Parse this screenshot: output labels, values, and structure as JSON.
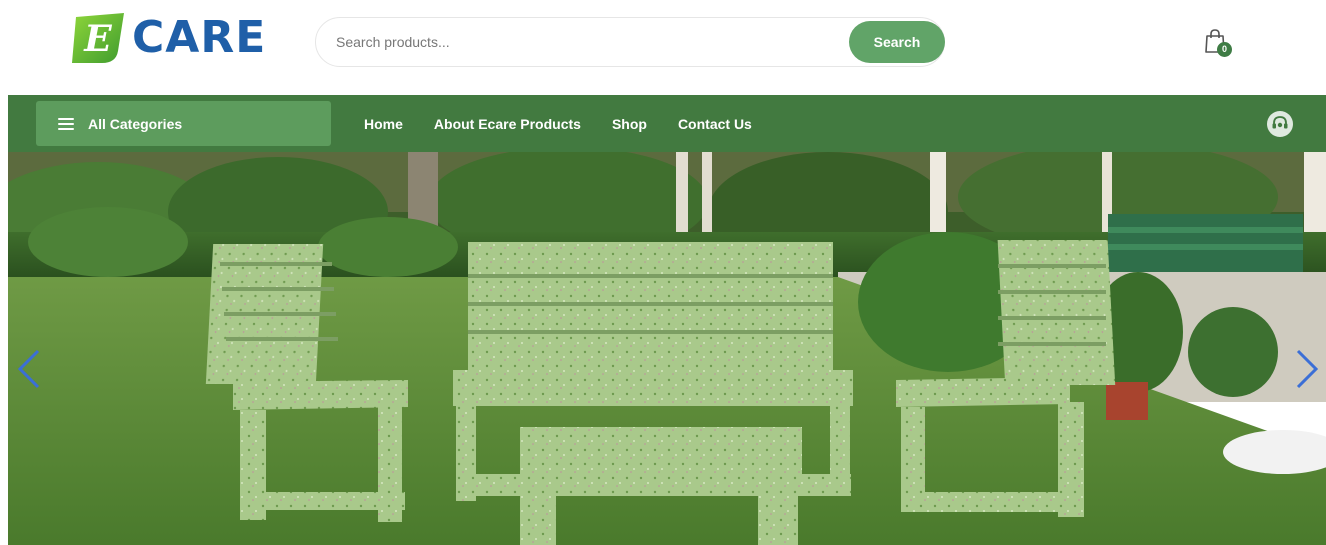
{
  "brand": {
    "logo_text": "CARE",
    "logo_letter": "E"
  },
  "search": {
    "placeholder": "Search products...",
    "button_label": "Search"
  },
  "cart": {
    "count": "0"
  },
  "nav": {
    "all_categories_label": "All Categories",
    "items": [
      {
        "label": "Home"
      },
      {
        "label": "About Ecare Products"
      },
      {
        "label": "Shop"
      },
      {
        "label": "Contact Us"
      }
    ]
  },
  "icons": {
    "cart": "shopping-bag-icon",
    "menu": "hamburger-icon",
    "support": "headset-support-icon",
    "prev": "chevron-left-icon",
    "next": "chevron-right-icon"
  },
  "colors": {
    "brand_blue": "#1f5fa8",
    "brand_green": "#61a468",
    "nav_bg": "#427a40",
    "categories_bg": "#5d9c5d",
    "arrow_blue": "#3b6fd6"
  }
}
